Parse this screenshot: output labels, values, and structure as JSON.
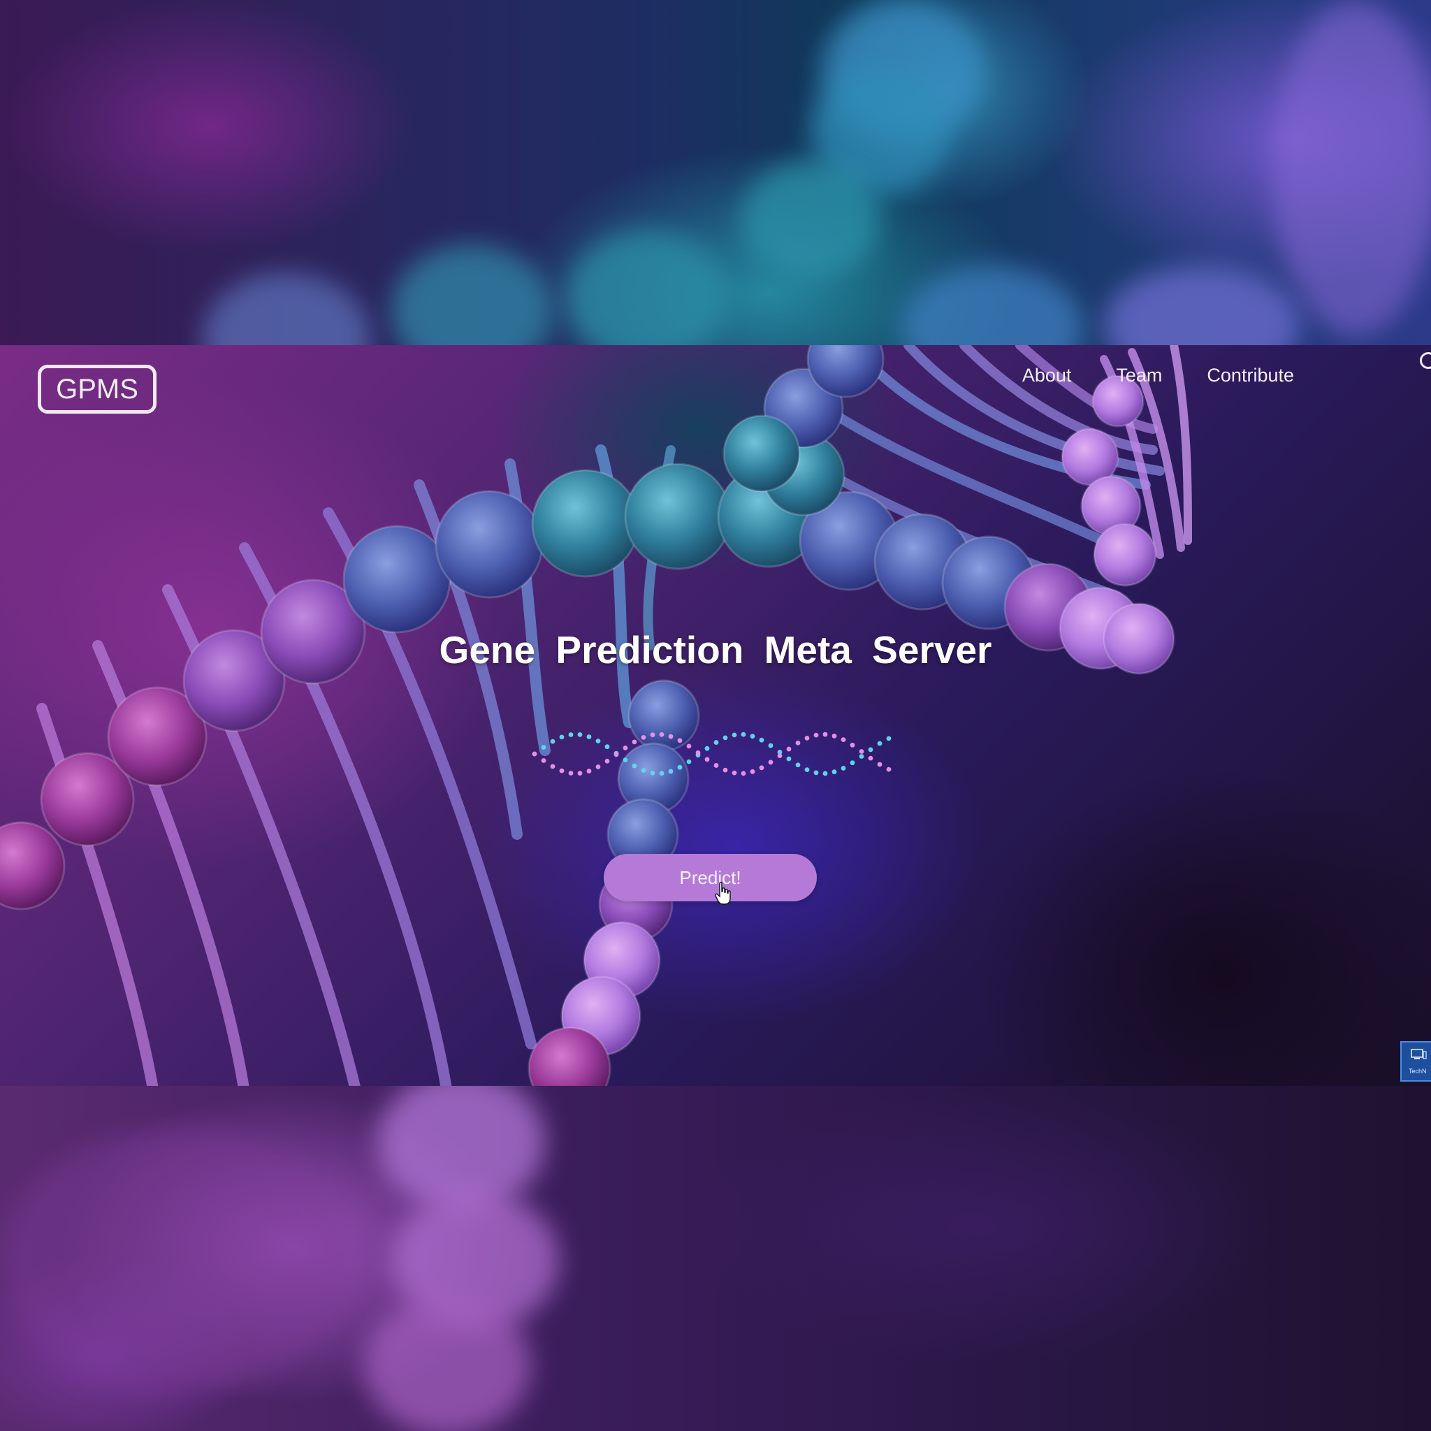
{
  "logo": {
    "text": "GPMS"
  },
  "nav": {
    "items": [
      {
        "label": "About"
      },
      {
        "label": "Team"
      },
      {
        "label": "Contribute"
      }
    ]
  },
  "hero": {
    "title": "Gene Prediction Meta Server",
    "button_label": "Predict!"
  },
  "corner_widget": {
    "text": "TechN"
  },
  "colors": {
    "button": "#b57ad8",
    "wave_cyan": "#5fd4ec",
    "wave_pink": "#e58fe6",
    "text": "#ffffff"
  },
  "icons": {
    "cursor": "hand-pointer-icon",
    "wave": "dna-dotted-wave-icon",
    "widget": "monitor-icon"
  }
}
